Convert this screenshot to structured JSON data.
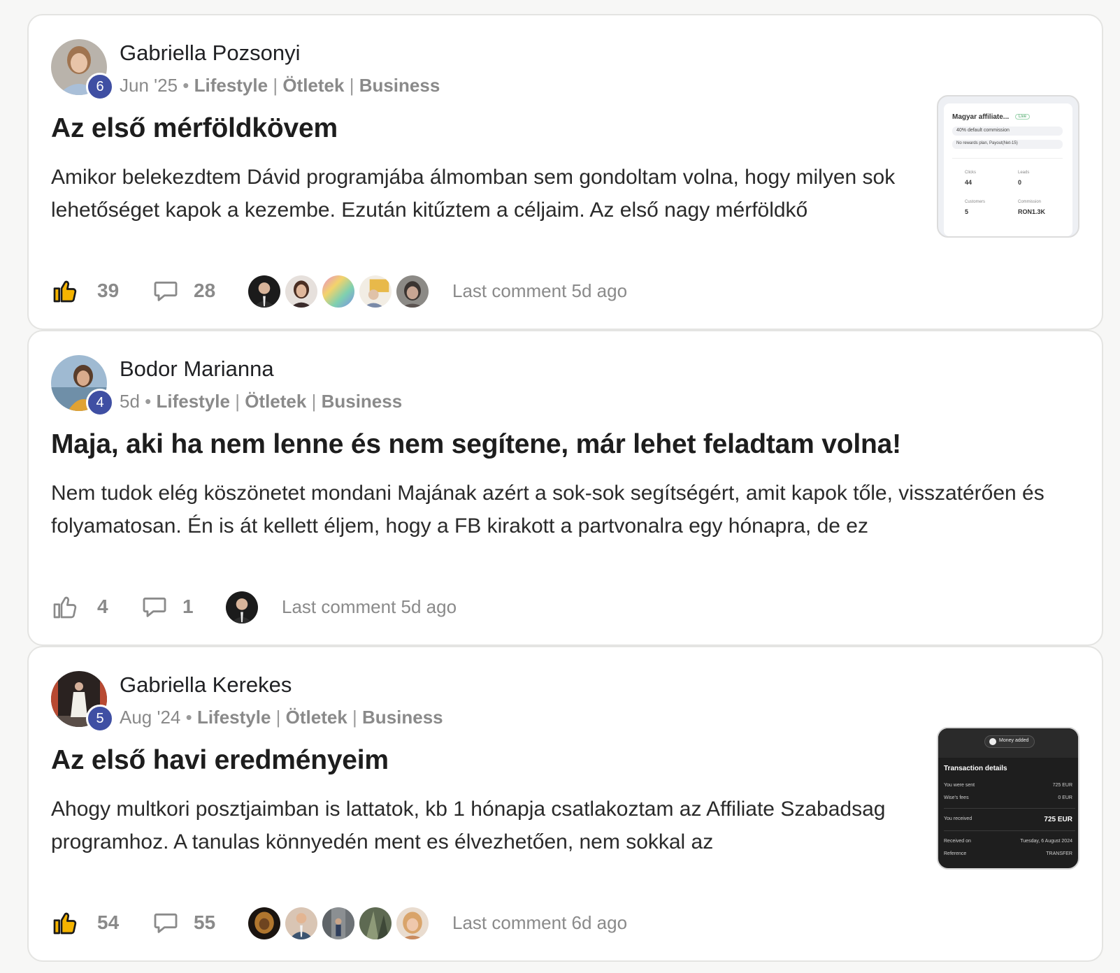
{
  "posts": [
    {
      "author": "Gabriella Pozsonyi",
      "level": "6",
      "date": "Jun '25",
      "categories": [
        "Lifestyle",
        "Ötletek",
        "Business"
      ],
      "title": "Az első mérföldkövem",
      "excerpt": "Amikor belekezdtem Dávid programjába álmomban sem gondoltam volna, hogy milyen sok lehetőséget kapok a kezembe. Ezután kitűztem a céljaim. Az első nagy mérföldkő",
      "likes": "39",
      "comments": "28",
      "last_comment": "Last comment 5d ago",
      "thumbnail": {
        "heading": "Magyar affiliate...",
        "badge": "Live",
        "row1": "40% default commission",
        "row2": "No rewards plan, Payout(Net-15)",
        "stats": [
          {
            "label": "Clicks",
            "value": "44"
          },
          {
            "label": "Leads",
            "value": "0"
          },
          {
            "label": "Customers",
            "value": "5"
          },
          {
            "label": "Commission",
            "value": "RON1.3K"
          }
        ]
      }
    },
    {
      "author": "Bodor Marianna",
      "level": "4",
      "date": "5d",
      "categories": [
        "Lifestyle",
        "Ötletek",
        "Business"
      ],
      "title": "Maja, aki ha nem lenne és nem segítene, már lehet feladtam volna!",
      "excerpt": "Nem tudok elég köszönetet mondani Majának azért a sok-sok segítségért, amit kapok tőle, visszatérően és folyamatosan. Én is át kellett éljem, hogy a FB kirakott a partvonalra egy hónapra, de ez",
      "likes": "4",
      "comments": "1",
      "last_comment": "Last comment 5d ago"
    },
    {
      "author": "Gabriella Kerekes",
      "level": "5",
      "date": "Aug '24",
      "categories": [
        "Lifestyle",
        "Ötletek",
        "Business"
      ],
      "title": "Az első havi eredményeim",
      "excerpt": "Ahogy multkori posztjaimban is lattatok, kb 1 hónapja csatlakoztam az Affiliate Szabadsag programhoz. A tanulas könnyedén ment es élvezhetően, nem sokkal az",
      "likes": "54",
      "comments": "55",
      "last_comment": "Last comment 6d ago",
      "thumbnail": {
        "chip": "Money added",
        "heading": "Transaction details",
        "rows": [
          {
            "label": "You were sent",
            "value": "725 EUR"
          },
          {
            "label": "Wise's fees",
            "value": "0 EUR"
          },
          {
            "label": "You received",
            "value": "725 EUR"
          },
          {
            "label": "Received on",
            "value": "Tuesday, 6 August 2024"
          },
          {
            "label": "Reference",
            "value": "TRANSFER"
          }
        ]
      }
    }
  ],
  "colors": {
    "background": "#f7f7f6",
    "card": "#ffffff",
    "badge": "#3f4fa3",
    "muted": "#8a8a8a"
  },
  "icons": [
    "thumbs-up-icon",
    "comment-icon"
  ]
}
